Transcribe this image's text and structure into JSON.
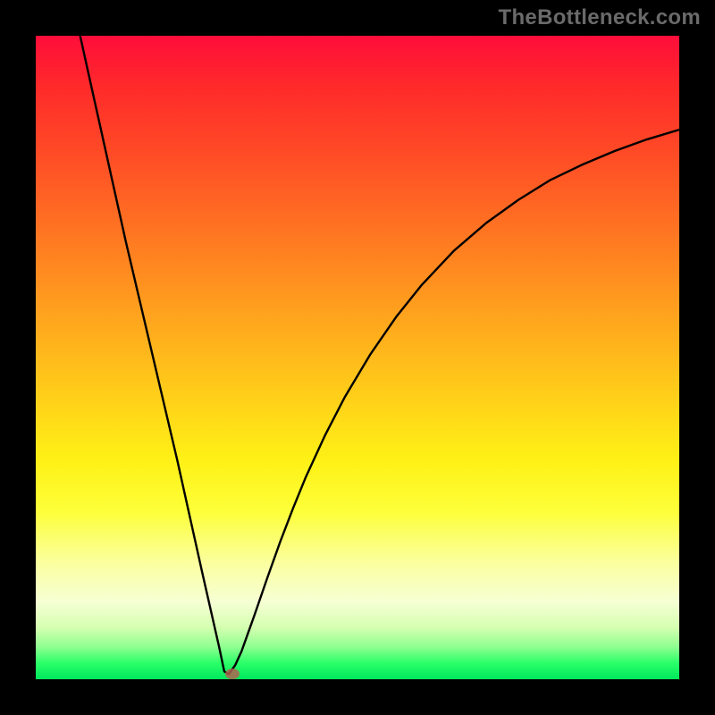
{
  "watermark": "TheBottleneck.com",
  "colors": {
    "background": "#000000",
    "curve": "#000000",
    "marker": "rgba(180,95,80,0.82)"
  },
  "chart_data": {
    "type": "line",
    "title": "",
    "xlabel": "",
    "ylabel": "",
    "xlim": [
      0,
      100
    ],
    "ylim": [
      0,
      100
    ],
    "grid": false,
    "legend": false,
    "series": [
      {
        "name": "bottleneck-curve",
        "x": [
          6.9,
          8,
          10,
          12,
          14,
          16,
          18,
          20,
          22,
          24,
          26,
          28.5,
          29.3,
          30,
          31,
          32,
          33,
          34,
          36,
          38,
          40,
          42,
          45,
          48,
          52,
          56,
          60,
          65,
          70,
          75,
          80,
          85,
          90,
          95,
          100
        ],
        "y": [
          100,
          95,
          86,
          77,
          68,
          59.5,
          51,
          42.5,
          34,
          25,
          16,
          5,
          1.2,
          0.8,
          2.2,
          4.4,
          7.2,
          10,
          15.8,
          21.4,
          26.6,
          31.5,
          38,
          43.8,
          50.5,
          56.3,
          61.3,
          66.6,
          70.9,
          74.5,
          77.6,
          80,
          82.1,
          83.9,
          85.4
        ]
      }
    ],
    "markers": [
      {
        "name": "selected-point",
        "x": 30.5,
        "y": 0.8
      }
    ]
  }
}
